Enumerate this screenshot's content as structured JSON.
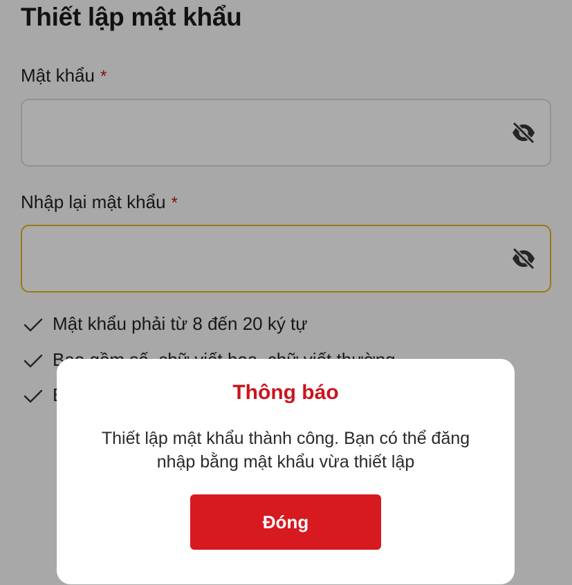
{
  "form": {
    "title": "Thiết lập mật khẩu",
    "password": {
      "label": "Mật khẩu",
      "required_mark": "*",
      "value": ""
    },
    "confirm_password": {
      "label": "Nhập lại mật khẩu",
      "required_mark": "*",
      "value": ""
    },
    "rules": [
      {
        "text": "Mật khẩu phải từ 8 đến 20 ký tự",
        "icon": "check-icon"
      },
      {
        "text": "Bao gồm số, chữ viết hoa, chữ viết thường",
        "icon": "check-icon"
      },
      {
        "text": "B",
        "icon": "check-icon"
      }
    ],
    "visibility_icon": "eye-slash-icon"
  },
  "dialog": {
    "title": "Thông báo",
    "message": "Thiết lập mật khẩu thành công. Bạn có thể đăng nhập bằng mật khẩu vừa thiết lập",
    "close_label": "Đóng"
  },
  "colors": {
    "brand_red": "#d71920",
    "title_red": "#c8161e",
    "focus_border": "#e0b420",
    "overlay": "rgba(0,0,0,0.33)"
  }
}
